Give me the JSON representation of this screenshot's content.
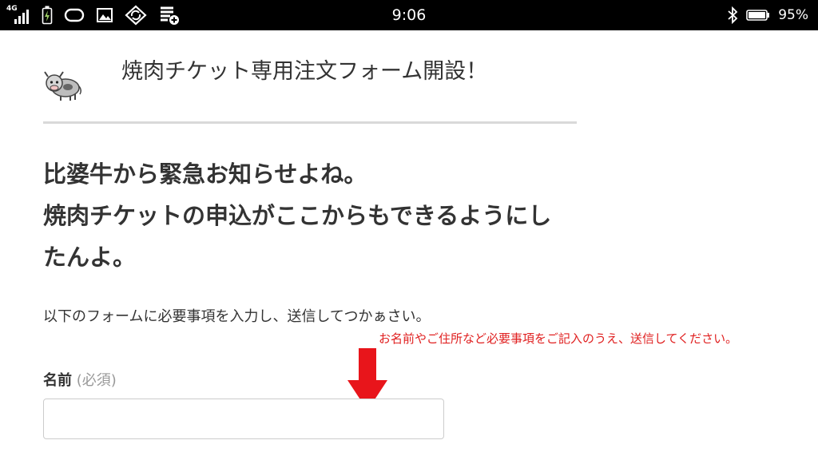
{
  "status_bar": {
    "network": "4G",
    "time": "9:06",
    "battery": "95%",
    "battery_level": 0.95,
    "icons": [
      "signal-icon",
      "battery-charging-icon",
      "notification-icon",
      "image-icon",
      "sync-icon",
      "storage-add-icon",
      "bluetooth-icon",
      "battery-icon"
    ]
  },
  "header": {
    "title": "焼肉チケット専用注文フォーム開設！",
    "logo": "cow-logo-icon"
  },
  "content": {
    "headline": [
      "比婆牛から緊急お知らせよね。",
      "焼肉チケットの申込がここからもできるようにしたんよ。"
    ],
    "intro": "以下のフォームに必要事項を入力し、送信してつかぁさい。",
    "annotation": "お名前やご住所など必要事項をご記入のうえ、送信してください。",
    "annotation_color": "#e02020",
    "arrow_color": "#e8151b"
  },
  "form": {
    "name_label": "名前",
    "required_label": "(必須)",
    "name_value": ""
  }
}
